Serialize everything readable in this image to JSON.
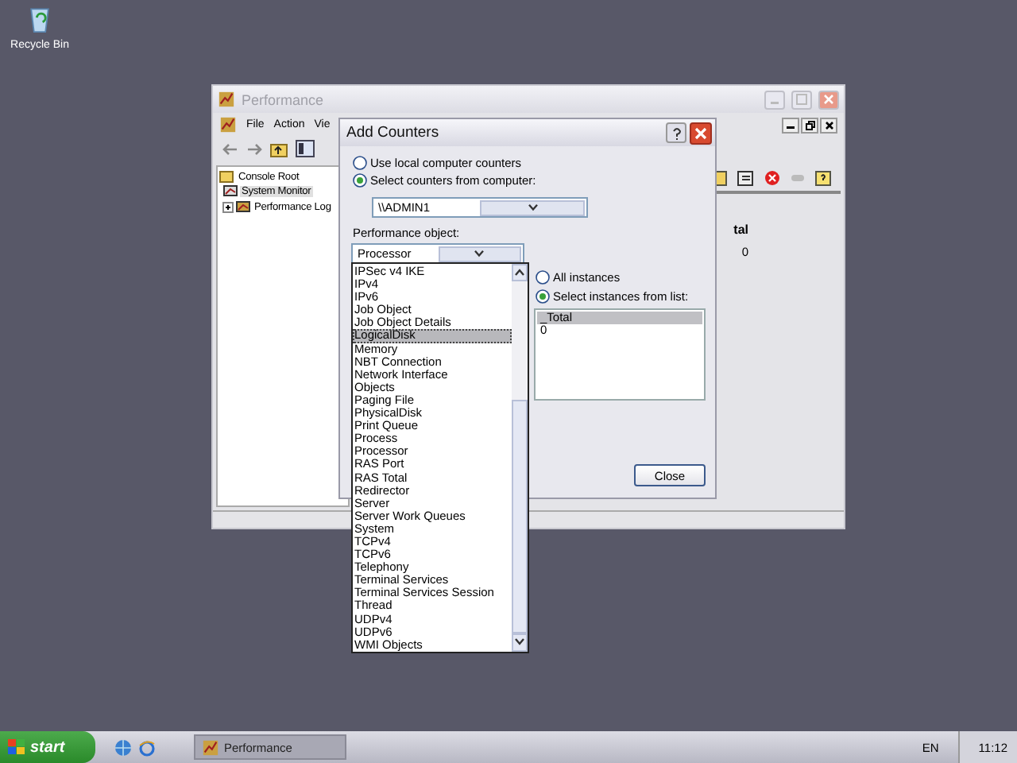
{
  "desktop_icons": [
    {
      "label": "Recycle Bin"
    }
  ],
  "performance_window": {
    "title": "Performance",
    "menu": [
      "File",
      "Action",
      "Vie"
    ],
    "tree": [
      {
        "label": "Console Root",
        "children": [
          {
            "label": "System Monitor",
            "selected": true
          },
          {
            "label": "Performance Log",
            "selected": false
          }
        ],
        "selected": false
      }
    ],
    "graph_header": "tal",
    "graph_value": "0"
  },
  "add_counters_dialog": {
    "title": "Add Counters",
    "source_options": [
      {
        "label": "Use local computer counters",
        "selected": false
      },
      {
        "label": "Select counters from computer:",
        "selected": true
      }
    ],
    "computer": "\\\\ADMIN1",
    "object_label": "Performance object:",
    "object_value": "Processor",
    "object_list": [
      {
        "label": "IPSec v4 IKE",
        "selected": false
      },
      {
        "label": "IPv4",
        "selected": false
      },
      {
        "label": "IPv6",
        "selected": false
      },
      {
        "label": "Job Object",
        "selected": false
      },
      {
        "label": "Job Object Details",
        "selected": false
      },
      {
        "label": "LogicalDisk",
        "selected": true
      },
      {
        "label": "Memory",
        "selected": false
      },
      {
        "label": "NBT Connection",
        "selected": false
      },
      {
        "label": "Network Interface",
        "selected": false
      },
      {
        "label": "Objects",
        "selected": false
      },
      {
        "label": "Paging File",
        "selected": false
      },
      {
        "label": "PhysicalDisk",
        "selected": false
      },
      {
        "label": "Print Queue",
        "selected": false
      },
      {
        "label": "Process",
        "selected": false
      },
      {
        "label": "Processor",
        "selected": false
      },
      {
        "label": "RAS Port",
        "selected": false
      },
      {
        "label": "RAS Total",
        "selected": false
      },
      {
        "label": "Redirector",
        "selected": false
      },
      {
        "label": "Server",
        "selected": false
      },
      {
        "label": "Server Work Queues",
        "selected": false
      },
      {
        "label": "System",
        "selected": false
      },
      {
        "label": "TCPv4",
        "selected": false
      },
      {
        "label": "TCPv6",
        "selected": false
      },
      {
        "label": "Telephony",
        "selected": false
      },
      {
        "label": "Terminal Services",
        "selected": false
      },
      {
        "label": "Terminal Services Session",
        "selected": false
      },
      {
        "label": "Thread",
        "selected": false
      },
      {
        "label": "UDPv4",
        "selected": false
      },
      {
        "label": "UDPv6",
        "selected": false
      },
      {
        "label": "WMI Objects",
        "selected": false
      }
    ],
    "instance_options": [
      {
        "label": "All instances",
        "selected": false
      },
      {
        "label": "Select instances from list:",
        "selected": true
      }
    ],
    "instances": [
      {
        "label": "_Total",
        "selected": true
      },
      {
        "label": "0",
        "selected": false
      }
    ],
    "close_button": "Close"
  },
  "taskbar": {
    "start": "start",
    "tasks": [
      {
        "label": "Performance",
        "selected": true
      }
    ],
    "language": "EN",
    "clock": "11:12"
  }
}
